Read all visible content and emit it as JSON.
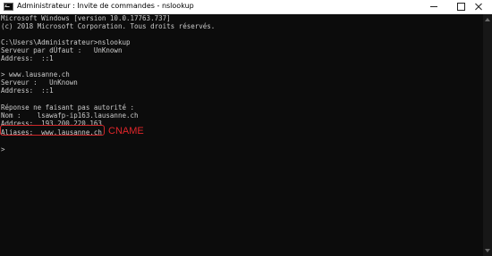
{
  "window": {
    "title": "Administrateur : Invite de commandes - nslookup",
    "app_icon": "cmd-icon",
    "controls": [
      "minimize-icon",
      "maximize-icon",
      "close-icon"
    ]
  },
  "console": {
    "lines": [
      "Microsoft Windows [version 10.0.17763.737]",
      "(c) 2018 Microsoft Corporation. Tous droits réservés.",
      "",
      "C:\\Users\\Administrateur>nslookup",
      "Serveur par dÚfaut :   UnKnown",
      "Address:  ::1",
      "",
      "> www.lausanne.ch",
      "Serveur :   UnKnown",
      "Address:  ::1",
      "",
      "Réponse ne faisant pas autorité :",
      "Nom :    lsawafp-ip163.lausanne.ch",
      "Address:  193.200.220.163",
      "Aliases:  www.lausanne.ch",
      "",
      ">"
    ]
  },
  "annotation": {
    "label": "CNAME",
    "color": "#e0262a"
  },
  "colors": {
    "console_bg": "#0c0c0c",
    "console_text": "#cccccc",
    "titlebar_bg": "#ffffff"
  }
}
